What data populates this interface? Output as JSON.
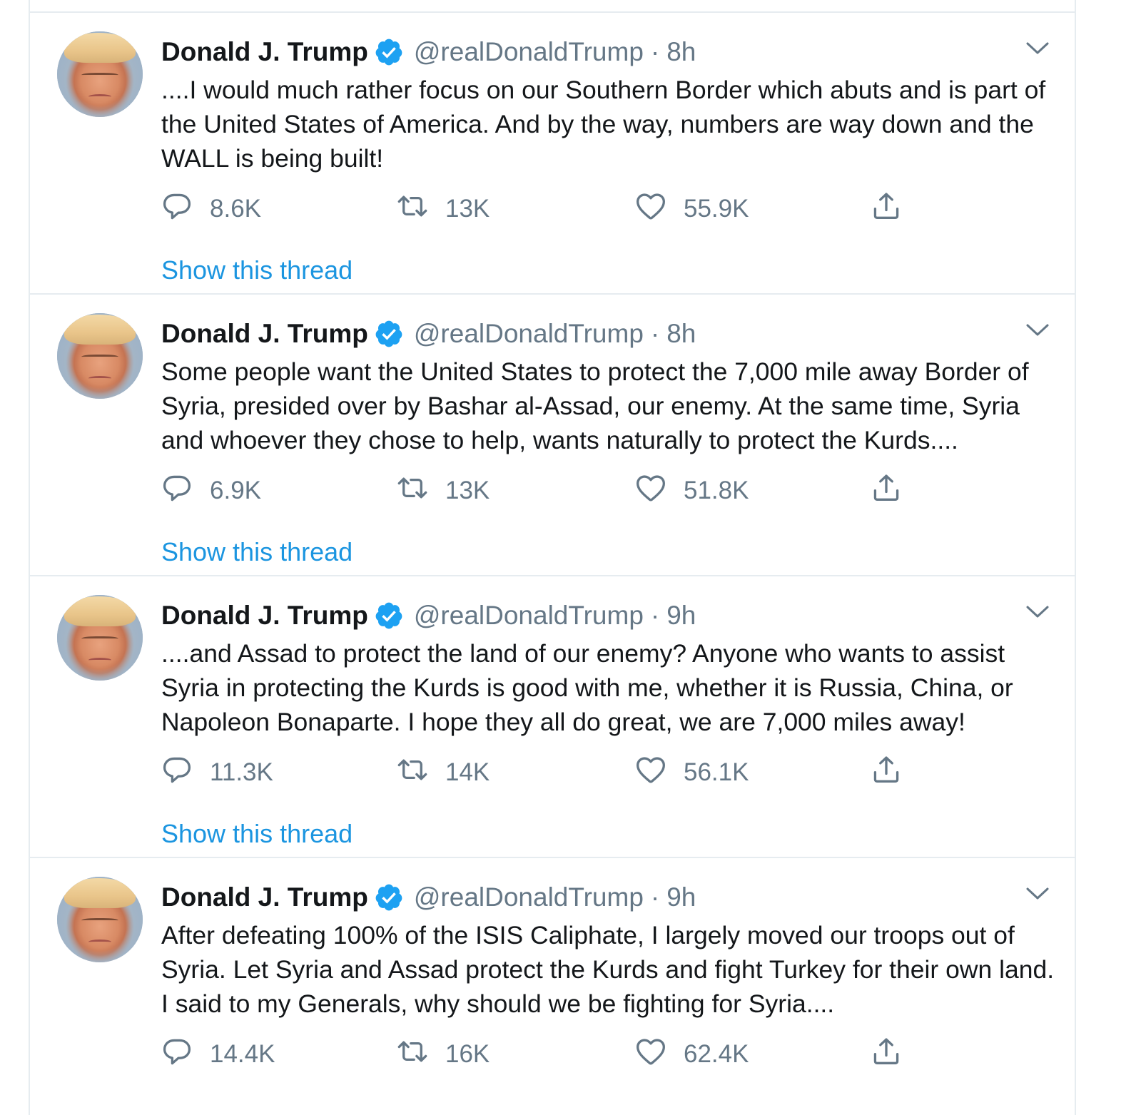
{
  "colors": {
    "link": "#1b95e0",
    "secondary_text": "#657786",
    "verified_badge": "#1da1f2",
    "divider": "#e6ecf0"
  },
  "tweets": [
    {
      "name": "Donald J. Trump",
      "handle": "@realDonaldTrump",
      "separator": "·",
      "time": "8h",
      "text": "....I would much rather focus on our Southern Border which abuts and is part of the United States of America. And by the way, numbers are way down and the WALL is being built!",
      "replies": "8.6K",
      "retweets": "13K",
      "likes": "55.9K",
      "thread_link": "Show this thread"
    },
    {
      "name": "Donald J. Trump",
      "handle": "@realDonaldTrump",
      "separator": "·",
      "time": "8h",
      "text": "Some people want the United States to protect the 7,000 mile away Border of Syria, presided over by Bashar al-Assad, our enemy. At the same time, Syria and whoever they chose to help, wants naturally to protect the Kurds....",
      "replies": "6.9K",
      "retweets": "13K",
      "likes": "51.8K",
      "thread_link": "Show this thread"
    },
    {
      "name": "Donald J. Trump",
      "handle": "@realDonaldTrump",
      "separator": "·",
      "time": "9h",
      "text": "....and Assad to protect the land of our enemy? Anyone who wants to assist Syria in protecting the Kurds is good with me, whether it is Russia, China, or Napoleon Bonaparte. I hope they all do great, we are 7,000 miles away!",
      "replies": "11.3K",
      "retweets": "14K",
      "likes": "56.1K",
      "thread_link": "Show this thread"
    },
    {
      "name": "Donald J. Trump",
      "handle": "@realDonaldTrump",
      "separator": "·",
      "time": "9h",
      "text": "After defeating 100% of the ISIS Caliphate, I largely moved our troops out of Syria. Let Syria and Assad protect the Kurds and fight Turkey for their own land. I said to my Generals, why should we be fighting for Syria....",
      "replies": "14.4K",
      "retweets": "16K",
      "likes": "62.4K",
      "thread_link": ""
    }
  ],
  "icons": {
    "reply": "reply-icon",
    "retweet": "retweet-icon",
    "like": "heart-icon",
    "share": "share-icon",
    "verified": "verified-badge-icon",
    "menu": "chevron-down-icon"
  }
}
